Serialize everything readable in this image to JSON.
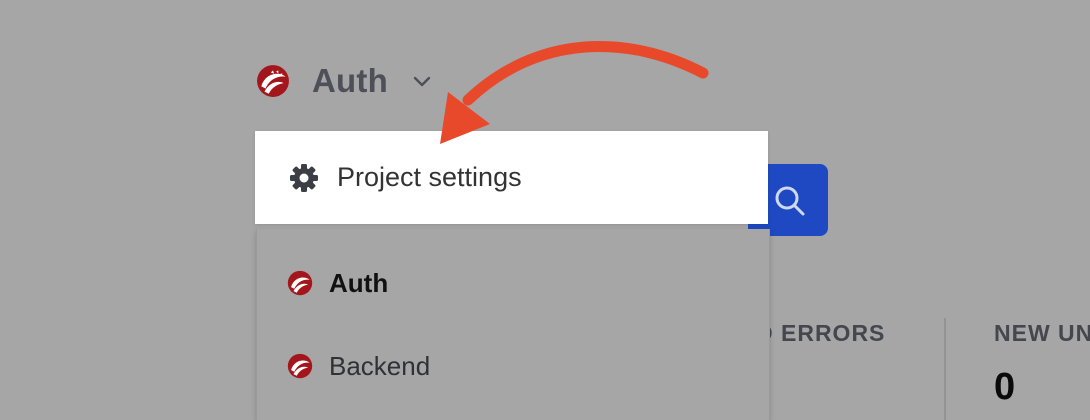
{
  "header": {
    "project_name": "Auth",
    "logo_icon": "project-logo-icon",
    "switch_icon": "chevron-down-icon"
  },
  "menu": {
    "settings_label": "Project settings",
    "settings_icon": "gear-icon",
    "projects": [
      {
        "label": "Auth",
        "active": true
      },
      {
        "label": "Backend",
        "active": false
      }
    ]
  },
  "search": {
    "icon": "search-icon"
  },
  "stats": {
    "col1_header": "D ERRORS",
    "col2_header": "NEW UN",
    "col2_value": "0"
  },
  "annotation": {
    "icon": "curved-arrow-icon",
    "color": "#e8492b"
  },
  "colors": {
    "overlay": "#a6a6a6",
    "accent": "#1f49c2",
    "logo_red": "#a3161c"
  }
}
